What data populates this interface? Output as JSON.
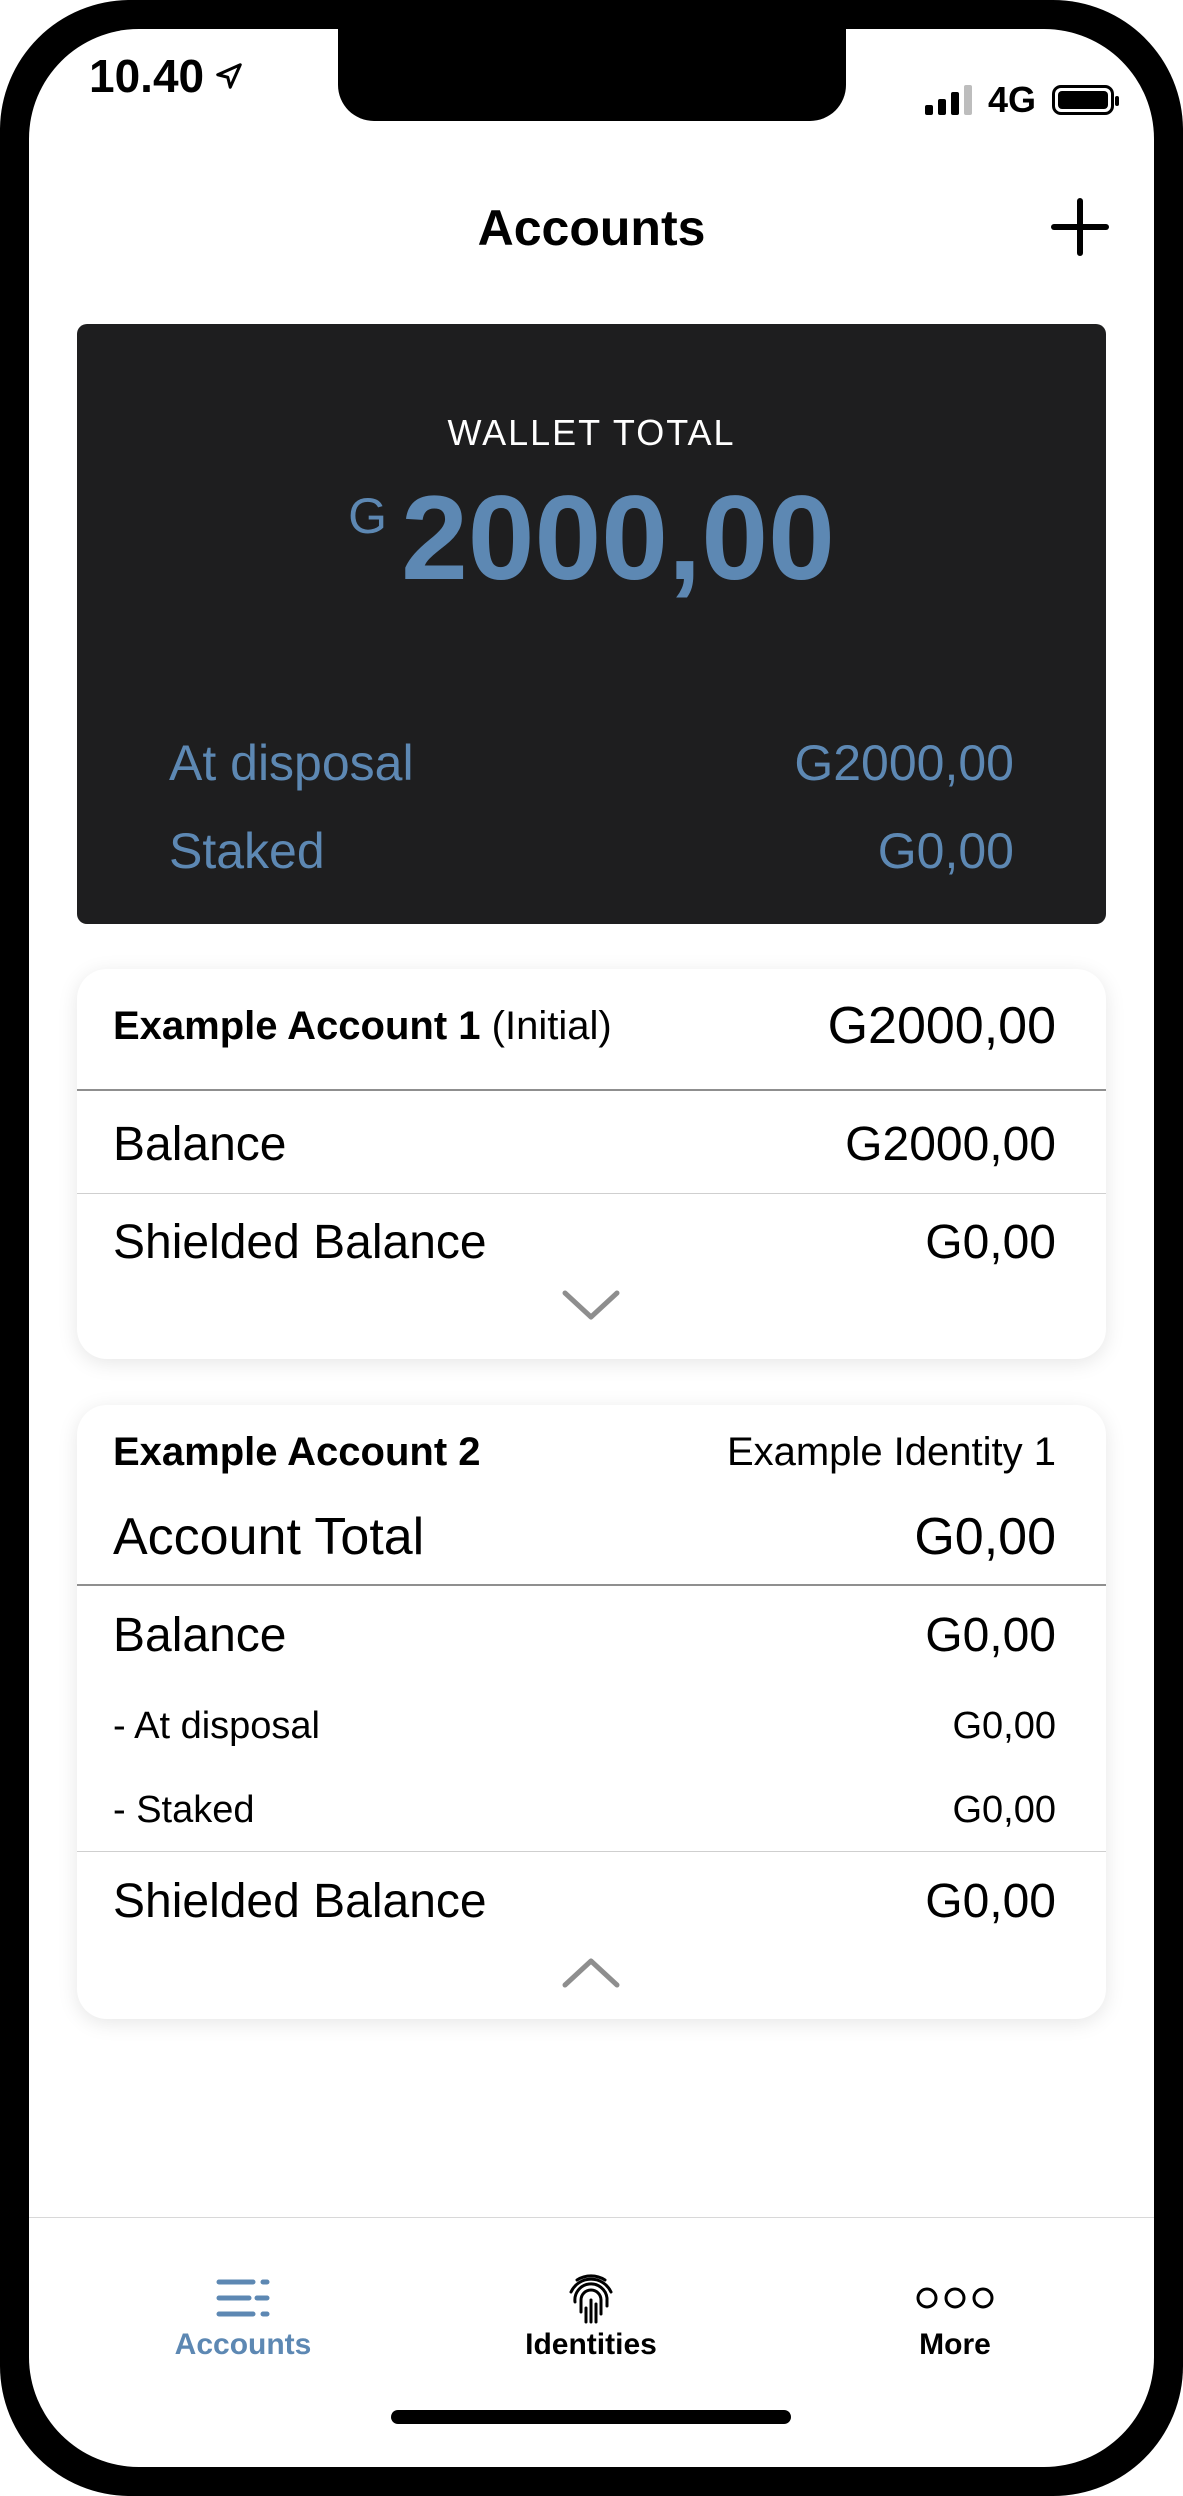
{
  "status_bar": {
    "time": "10.40",
    "network": "4G"
  },
  "header": {
    "title": "Accounts"
  },
  "wallet": {
    "label": "WALLET TOTAL",
    "currency": "G",
    "total": "2000,00",
    "rows": [
      {
        "label": "At disposal",
        "value": "G2000,00"
      },
      {
        "label": "Staked",
        "value": "G0,00"
      }
    ]
  },
  "account1": {
    "name": "Example Account 1",
    "tag": "(Initial)",
    "total": "G2000,00",
    "balance_label": "Balance",
    "balance_value": "G2000,00",
    "shielded_label": "Shielded Balance",
    "shielded_value": "G0,00"
  },
  "account2": {
    "name": "Example Account 2",
    "identity": "Example Identity 1",
    "total_label": "Account Total",
    "total_value": "G0,00",
    "balance_label": "Balance",
    "balance_value": "G0,00",
    "at_disposal_label": "- At disposal",
    "at_disposal_value": "G0,00",
    "staked_label": "- Staked",
    "staked_value": "G0,00",
    "shielded_label": "Shielded Balance",
    "shielded_value": "G0,00"
  },
  "tabs": [
    {
      "label": "Accounts",
      "icon": "accounts-list-icon",
      "active": true
    },
    {
      "label": "Identities",
      "icon": "fingerprint-icon",
      "active": false
    },
    {
      "label": "More",
      "icon": "more-dots-icon",
      "active": false
    }
  ],
  "colors": {
    "accent": "#5d88b3",
    "wallet_bg": "#1e1e1f",
    "text": "#000000"
  }
}
